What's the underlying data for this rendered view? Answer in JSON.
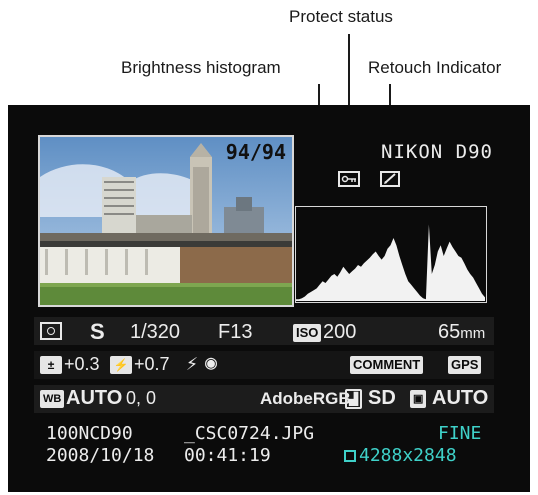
{
  "callouts": {
    "protect": "Protect status",
    "histogram": "Brightness histogram",
    "retouch": "Retouch Indicator"
  },
  "screen": {
    "frame_count": "94/94",
    "camera_model": "NIKON D90",
    "histogram_values": [
      0.02,
      0.02,
      0.03,
      0.05,
      0.08,
      0.1,
      0.12,
      0.14,
      0.18,
      0.22,
      0.2,
      0.24,
      0.28,
      0.3,
      0.27,
      0.32,
      0.38,
      0.34,
      0.3,
      0.33,
      0.36,
      0.4,
      0.38,
      0.42,
      0.45,
      0.48,
      0.52,
      0.55,
      0.5,
      0.46,
      0.5,
      0.58,
      0.62,
      0.7,
      0.62,
      0.5,
      0.4,
      0.3,
      0.22,
      0.18,
      0.14,
      0.1,
      0.06,
      0.03,
      0.02,
      0.85,
      0.3,
      0.4,
      0.55,
      0.62,
      0.5,
      0.58,
      0.66,
      0.6,
      0.55,
      0.5,
      0.48,
      0.42,
      0.35,
      0.3,
      0.26,
      0.2,
      0.14,
      0.08,
      0.04
    ],
    "row1": {
      "metering_icon": "matrix-metering-icon",
      "mode": "S",
      "shutter": "1/320",
      "aperture": "F13",
      "iso_label": "ISO",
      "iso_value": "200",
      "focal_value": "65",
      "focal_unit": "mm"
    },
    "row2": {
      "exp_comp": "+0.3",
      "flash_comp": "+0.7",
      "flash_icon": "flash-icon",
      "redeye_icon": "red-eye-icon",
      "comment": "COMMENT",
      "gps": "GPS"
    },
    "row3": {
      "wb_label": "WB",
      "wb_value": "AUTO",
      "wb_fine": "0, 0",
      "color_space": "AdobeRGB",
      "picture_control": "SD",
      "active_dlighting": "AUTO"
    },
    "row4": {
      "folder": "100NCD90",
      "filename": "_CSC0724.JPG",
      "quality": "FINE",
      "date": "2008/10/18",
      "time": "00:41:19",
      "size": "4288x2848"
    }
  }
}
